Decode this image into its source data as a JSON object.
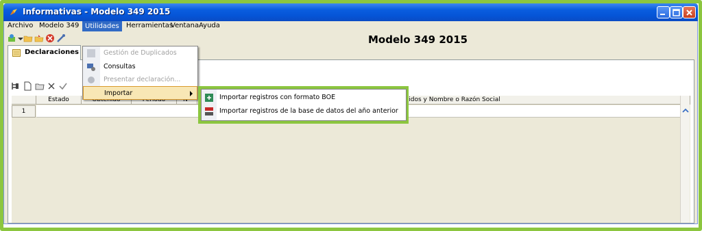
{
  "window": {
    "title": "Informativas - Modelo 349 2015"
  },
  "menubar": {
    "items": [
      "Archivo",
      "Modelo 349",
      "Utilidades",
      "Herramientas",
      "Ventana",
      "Ayuda"
    ],
    "active": "Utilidades"
  },
  "toolbar": {
    "page_title": "Modelo 349 2015"
  },
  "tabs": [
    {
      "label": "Declaraciones"
    }
  ],
  "grid": {
    "columns": [
      "Estado",
      "Obtenido",
      "Período",
      "Nº",
      "pellidos y Nombre o Razón Social"
    ],
    "rows": [
      {
        "num": "1"
      }
    ]
  },
  "utilidades_menu": {
    "items": [
      {
        "label": "Gestión de Duplicados",
        "enabled": false
      },
      {
        "label": "Consultas",
        "enabled": true
      },
      {
        "label": "Presentar declaración...",
        "enabled": false
      },
      {
        "label": "Importar",
        "enabled": true,
        "submenu": true
      }
    ]
  },
  "importar_submenu": {
    "items": [
      {
        "label": "Importar registros con formato BOE"
      },
      {
        "label": "Importar registros de la base de datos del año anterior"
      }
    ]
  },
  "colors": {
    "highlight": "#8cc63f",
    "titlebar": "#0a5ee0",
    "menu_active": "#316ac5",
    "hover": "#f8e7b5"
  }
}
